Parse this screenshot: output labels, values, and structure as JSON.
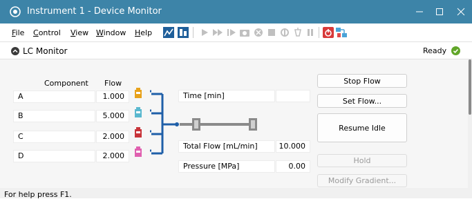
{
  "window": {
    "title": "Instrument 1 - Device Monitor",
    "minimize": "—",
    "maximize": "☐",
    "close": "✕"
  },
  "menu": {
    "file_u": "F",
    "file_rest": "ile",
    "control_u": "C",
    "control_rest": "ontrol",
    "view_u": "V",
    "view_rest": "iew",
    "window_u": "W",
    "window_rest": "indow",
    "help_u": "H",
    "help_rest": "elp"
  },
  "toolbar": {
    "icons": [
      "chart-icon",
      "instrument-icon",
      "play-icon",
      "fast-forward-icon",
      "step-icon",
      "camera-icon",
      "stop-circle-icon",
      "stop-square-icon",
      "valve-icon",
      "lamp-icon",
      "pause-icon",
      "power-icon",
      "network-icon"
    ],
    "colors": {
      "active": "#1f5f9a",
      "disabled": "#c0c0c0",
      "power": "#d83a3a"
    }
  },
  "panel": {
    "title": "LC Monitor",
    "status": "Ready",
    "status_color": "#61a629"
  },
  "table": {
    "col_component": "Component",
    "col_flow": "Flow",
    "rows": [
      {
        "component": "A",
        "flow": "1.000",
        "color": "#e8a21b"
      },
      {
        "component": "B",
        "flow": "5.000",
        "color": "#5ab8cf"
      },
      {
        "component": "C",
        "flow": "2.000",
        "color": "#c8343a"
      },
      {
        "component": "D",
        "flow": "2.000",
        "color": "#e060b0"
      }
    ]
  },
  "readouts": {
    "time_label": "Time [min]",
    "time_value": "",
    "total_flow_label": "Total Flow [mL/min]",
    "total_flow_value": "10.000",
    "pressure_label": "Pressure [MPa]",
    "pressure_value": "0.00"
  },
  "buttons": {
    "stop_flow": "Stop Flow",
    "set_flow": "Set Flow...",
    "resume_idle": "Resume Idle",
    "hold": "Hold",
    "modify_gradient": "Modify Gradient..."
  },
  "statusbar": {
    "help_text": "For help press F1."
  }
}
